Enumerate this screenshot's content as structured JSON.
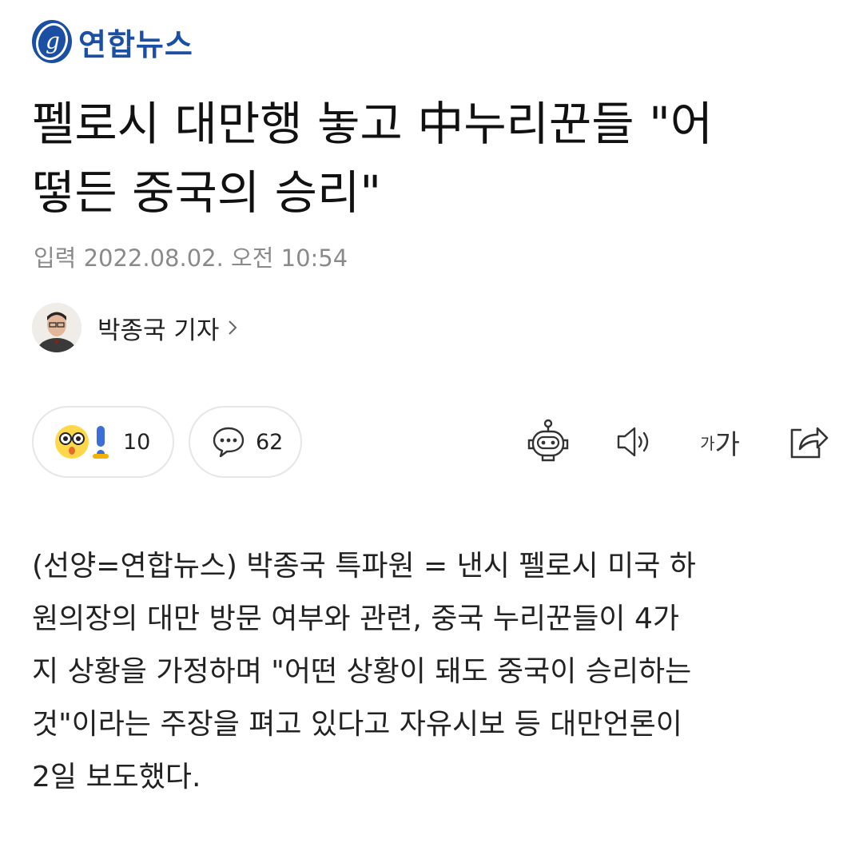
{
  "header": {
    "logo_text": "연합뉴스"
  },
  "article": {
    "title_line1": "펠로시 대만행 놓고 中누리꾼들 \"어",
    "title_line2": "떻든 중국의 승리\"",
    "dateline": "입력 2022.08.02. 오전 10:54",
    "reporter": "박종국 기자",
    "body": [
      "(선양=연합뉴스) 박종국 특파원 = 낸시 펠로시 미국 하",
      "원의장의 대만 방문 여부와 관련, 중국 누리꾼들이 4가",
      "지 상황을 가정하며 \"어떤 상황이 돼도 중국이 승리하는",
      "것\"이라는 주장을 펴고 있다고 자유시보 등 대만언론이",
      "2일 보도했다."
    ]
  },
  "actions": {
    "reaction_count": "10",
    "comment_count": "62",
    "font_small_label": "가",
    "font_big_label": "가"
  },
  "colors": {
    "brand": "#1a4fa3",
    "border": "#e6e6e6",
    "muted": "#8a8a8a"
  },
  "icons": [
    "yonhap-logo-icon",
    "avatar",
    "chevron-right-icon",
    "surprised-emoji-icon",
    "comment-bubble-icon",
    "robot-summary-icon",
    "speaker-icon",
    "share-icon"
  ]
}
